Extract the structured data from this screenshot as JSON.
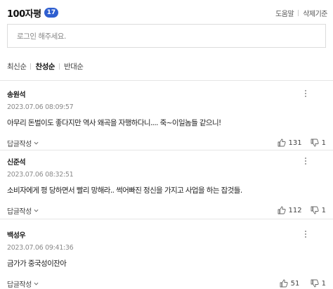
{
  "header": {
    "title": "100자평",
    "count": "17",
    "help_label": "도움말",
    "delete_policy_label": "삭제기준"
  },
  "login_prompt": "로그인 해주세요.",
  "sort_tabs": [
    {
      "label": "최신순",
      "active": false
    },
    {
      "label": "찬성순",
      "active": true
    },
    {
      "label": "반대순",
      "active": false
    }
  ],
  "comments": [
    {
      "author": "송원석",
      "date": "2023.07.06 08:09:57",
      "text": "아무리 돈벌이도 좋다지만 역사 왜곡을 자행하다니.... 죽~이일놈들 같으니!",
      "reply_label": "답글작성",
      "likes": "131",
      "dislikes": "1"
    },
    {
      "author": "신준석",
      "date": "2023.07.06 08:32:51",
      "text": "소비자에게 평 당하면서 빨리 망해라.. 썩어빠진 정신을 가지고 사업을 하는 잡것들.",
      "reply_label": "답글작성",
      "likes": "112",
      "dislikes": "1"
    },
    {
      "author": "백성우",
      "date": "2023.07.06 09:41:36",
      "text": "금가가 중국성이잔아",
      "reply_label": "답글작성",
      "likes": "51",
      "dislikes": "1"
    }
  ],
  "colors": {
    "badge": "#2f5fd0",
    "border": "#dcdcdc",
    "date": "#8a8a8a"
  }
}
